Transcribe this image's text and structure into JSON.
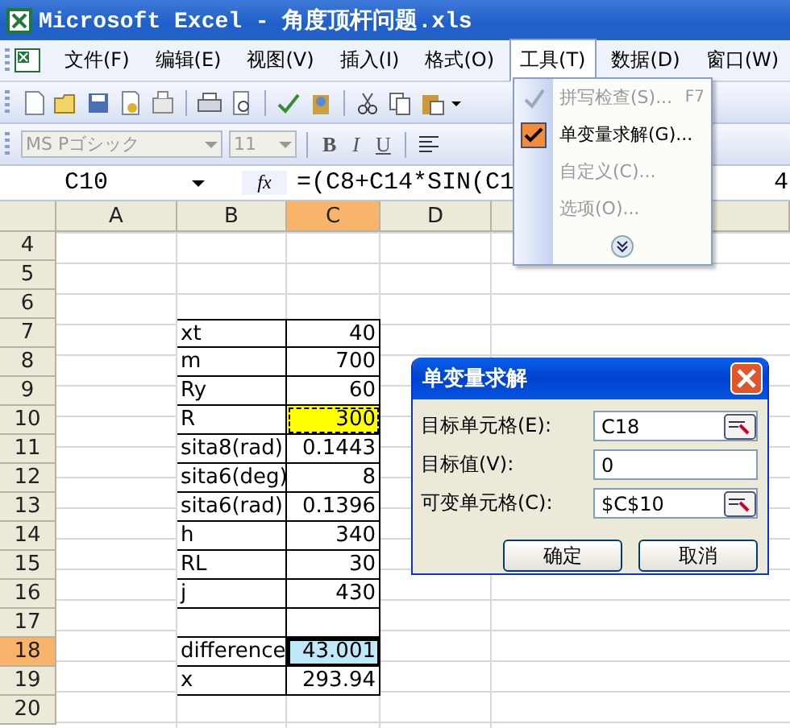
{
  "window": {
    "title": "Microsoft Excel - 角度顶杆问题.xls"
  },
  "menu_bar": [
    {
      "label": "文件(F)",
      "selected": false
    },
    {
      "label": "编辑(E)",
      "selected": false
    },
    {
      "label": "视图(V)",
      "selected": false
    },
    {
      "label": "插入(I)",
      "selected": false
    },
    {
      "label": "格式(O)",
      "selected": false
    },
    {
      "label": "工具(T)",
      "selected": true
    },
    {
      "label": "数据(D)",
      "selected": false
    },
    {
      "label": "窗口(W)",
      "selected": false
    }
  ],
  "format_toolbar": {
    "font": "MS Pゴシック",
    "size": "11",
    "styles": [
      "B",
      "I",
      "U"
    ]
  },
  "formula_bar": {
    "name_box": "C10",
    "function_label": "fx",
    "formula": "=(C8+C14*SIN(C1",
    "formula_tail": "4"
  },
  "sheet": {
    "columns": [
      {
        "label": "A",
        "selected": false
      },
      {
        "label": "B",
        "selected": false
      },
      {
        "label": "C",
        "selected": true
      },
      {
        "label": "D",
        "selected": false
      }
    ],
    "rows": [
      {
        "header": "4",
        "selected": false,
        "bordered": false
      },
      {
        "header": "5",
        "selected": false,
        "bordered": false
      },
      {
        "header": "6",
        "selected": false,
        "bordered": false
      },
      {
        "header": "7",
        "selected": false,
        "bordered": true,
        "label": "xt",
        "value": "40",
        "cell_selected": false,
        "cell_marquee": false
      },
      {
        "header": "8",
        "selected": false,
        "bordered": true,
        "label": "m",
        "value": "700",
        "cell_selected": false,
        "cell_marquee": false
      },
      {
        "header": "9",
        "selected": false,
        "bordered": true,
        "label": "Ry",
        "value": "60",
        "cell_selected": false,
        "cell_marquee": false
      },
      {
        "header": "10",
        "selected": false,
        "bordered": true,
        "label": "R",
        "value": "300",
        "cell_selected": false,
        "cell_marquee": true,
        "highlighted": true
      },
      {
        "header": "11",
        "selected": false,
        "bordered": true,
        "label": "sita8(rad)",
        "value": "0.1443",
        "cell_selected": false,
        "cell_marquee": false
      },
      {
        "header": "12",
        "selected": false,
        "bordered": true,
        "label": "sita6(deg)",
        "value": "8",
        "cell_selected": false,
        "cell_marquee": false
      },
      {
        "header": "13",
        "selected": false,
        "bordered": true,
        "label": "sita6(rad)",
        "value": "0.1396",
        "cell_selected": false,
        "cell_marquee": false
      },
      {
        "header": "14",
        "selected": false,
        "bordered": true,
        "label": "h",
        "value": "340",
        "cell_selected": false,
        "cell_marquee": false
      },
      {
        "header": "15",
        "selected": false,
        "bordered": true,
        "label": "RL",
        "value": "30",
        "cell_selected": false,
        "cell_marquee": false
      },
      {
        "header": "16",
        "selected": false,
        "bordered": true,
        "label": "j",
        "value": "430",
        "cell_selected": false,
        "cell_marquee": false
      },
      {
        "header": "17",
        "selected": false,
        "bordered": true,
        "cell_selected": false,
        "cell_marquee": false
      },
      {
        "header": "18",
        "selected": true,
        "bordered": true,
        "label": "difference",
        "value": "43.001",
        "cell_selected": true,
        "cell_marquee": false
      },
      {
        "header": "19",
        "selected": false,
        "bordered": true,
        "label": "x",
        "value": "293.94",
        "cell_selected": false,
        "cell_marquee": false
      },
      {
        "header": "20",
        "selected": false,
        "bordered": false
      }
    ]
  },
  "tools_menu": {
    "items": [
      {
        "label": "拼写检查(S)...",
        "shortcut": "F7",
        "disabled": true,
        "checked": false
      },
      {
        "label": "单变量求解(G)...",
        "disabled": false,
        "checked": true
      },
      {
        "label": "自定义(C)...",
        "disabled": true,
        "checked": false
      },
      {
        "label": "选项(O)...",
        "disabled": true,
        "checked": false
      }
    ]
  },
  "dialog": {
    "title": "单变量求解",
    "fields": [
      {
        "label": "目标单元格(E):",
        "value": "C18",
        "ref_button": true
      },
      {
        "label": "目标值(V):",
        "value": "0",
        "ref_button": false
      },
      {
        "label": "可变单元格(C):",
        "value": "$C$10",
        "ref_button": true
      }
    ],
    "buttons": [
      "确定",
      "取消"
    ]
  }
}
